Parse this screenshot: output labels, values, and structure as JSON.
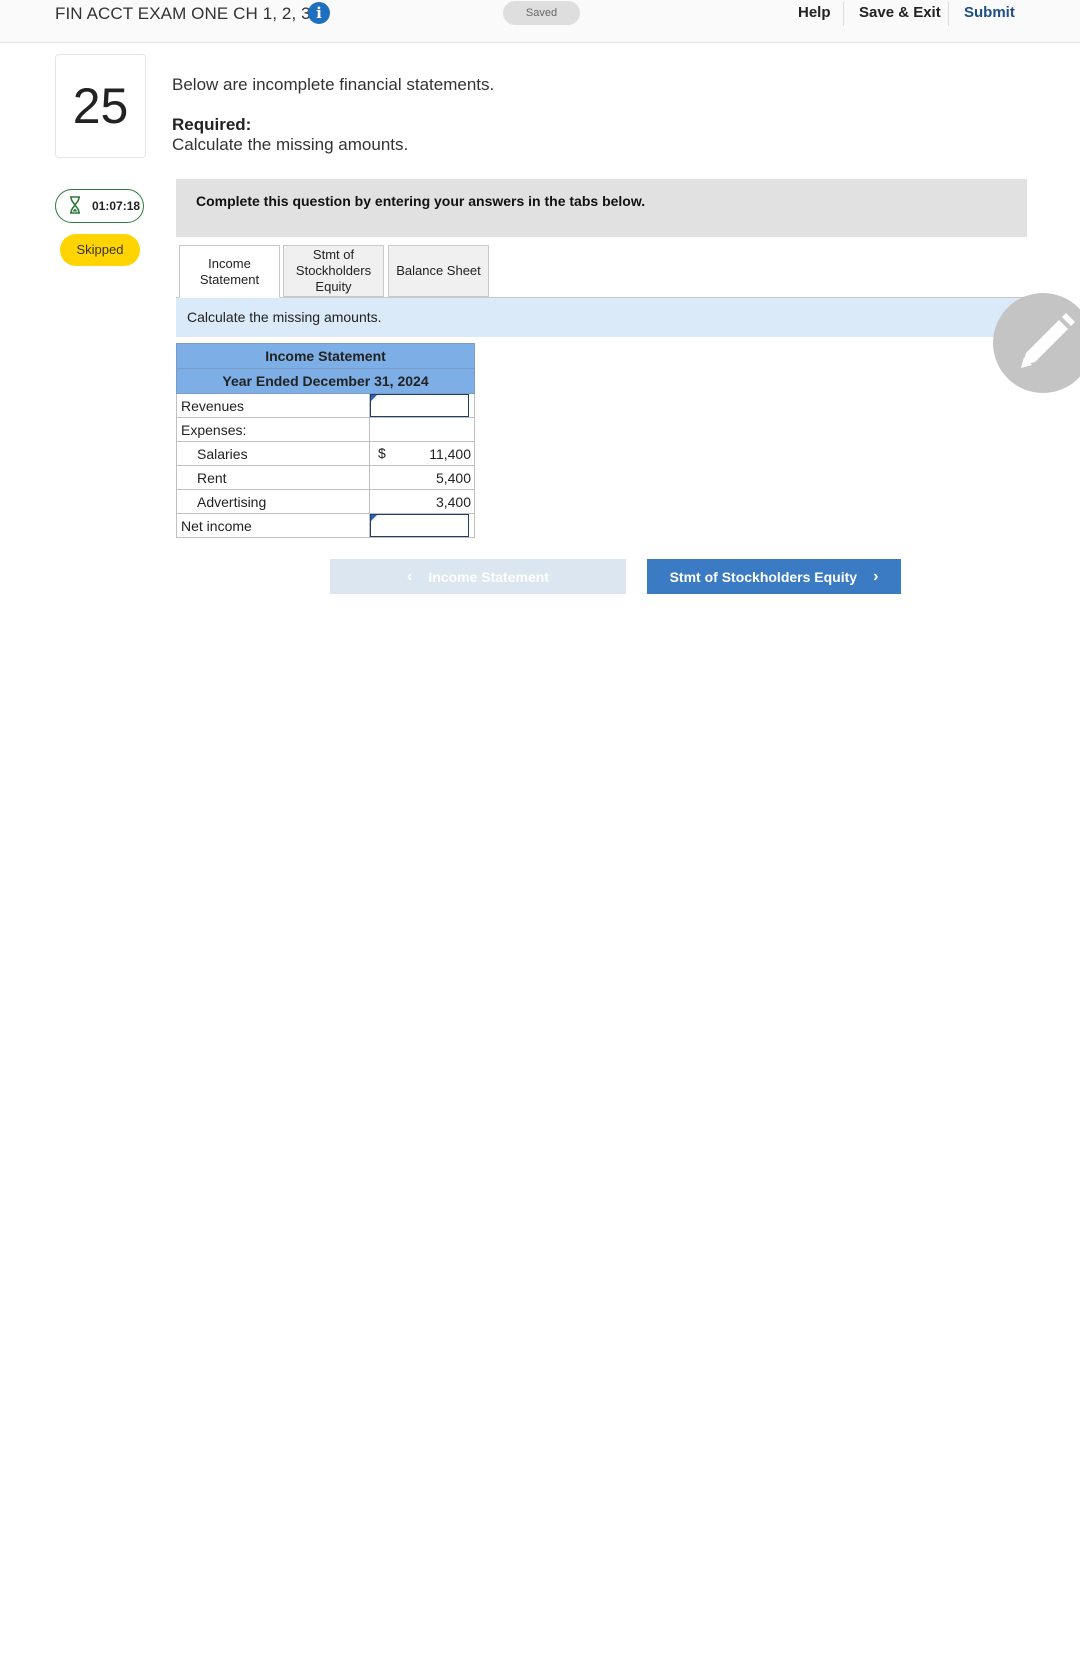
{
  "header": {
    "exam_title": "FIN ACCT EXAM ONE CH 1, 2, 3",
    "info_icon": "info-icon",
    "saved_status": "Saved",
    "help": "Help",
    "save_exit": "Save & Exit",
    "submit": "Submit"
  },
  "question": {
    "number": "25",
    "timer": "01:07:18",
    "status_badge": "Skipped",
    "prompt": "Below are incomplete financial statements.",
    "required_label": "Required:",
    "required_text": "Calculate the missing amounts.",
    "instruction": "Complete this question by entering your answers in the tabs below."
  },
  "tabs": [
    {
      "label": "Income\nStatement",
      "active": true
    },
    {
      "label": "Stmt of\nStockholders\nEquity",
      "active": false
    },
    {
      "label": "Balance Sheet",
      "active": false
    }
  ],
  "tab_panel": {
    "instruction": "Calculate the missing amounts."
  },
  "income_statement": {
    "title": "Income Statement",
    "period": "Year Ended December 31, 2024",
    "rows": [
      {
        "label": "Revenues",
        "value": "",
        "input": true
      },
      {
        "label": "Expenses:",
        "value": ""
      },
      {
        "label": "Salaries",
        "currency": "$",
        "value": "11,400"
      },
      {
        "label": "Rent",
        "value": "5,400"
      },
      {
        "label": "Advertising",
        "value": "3,400"
      },
      {
        "label": "Net income",
        "value": "",
        "input": true
      }
    ]
  },
  "navigation": {
    "prev_label": "Income Statement",
    "next_label": "Stmt of Stockholders Equity"
  },
  "colors": {
    "accent": "#3b7bc3",
    "table_header": "#7eaee6",
    "badge": "#ffd400",
    "timer_border": "#2c7a3d"
  }
}
